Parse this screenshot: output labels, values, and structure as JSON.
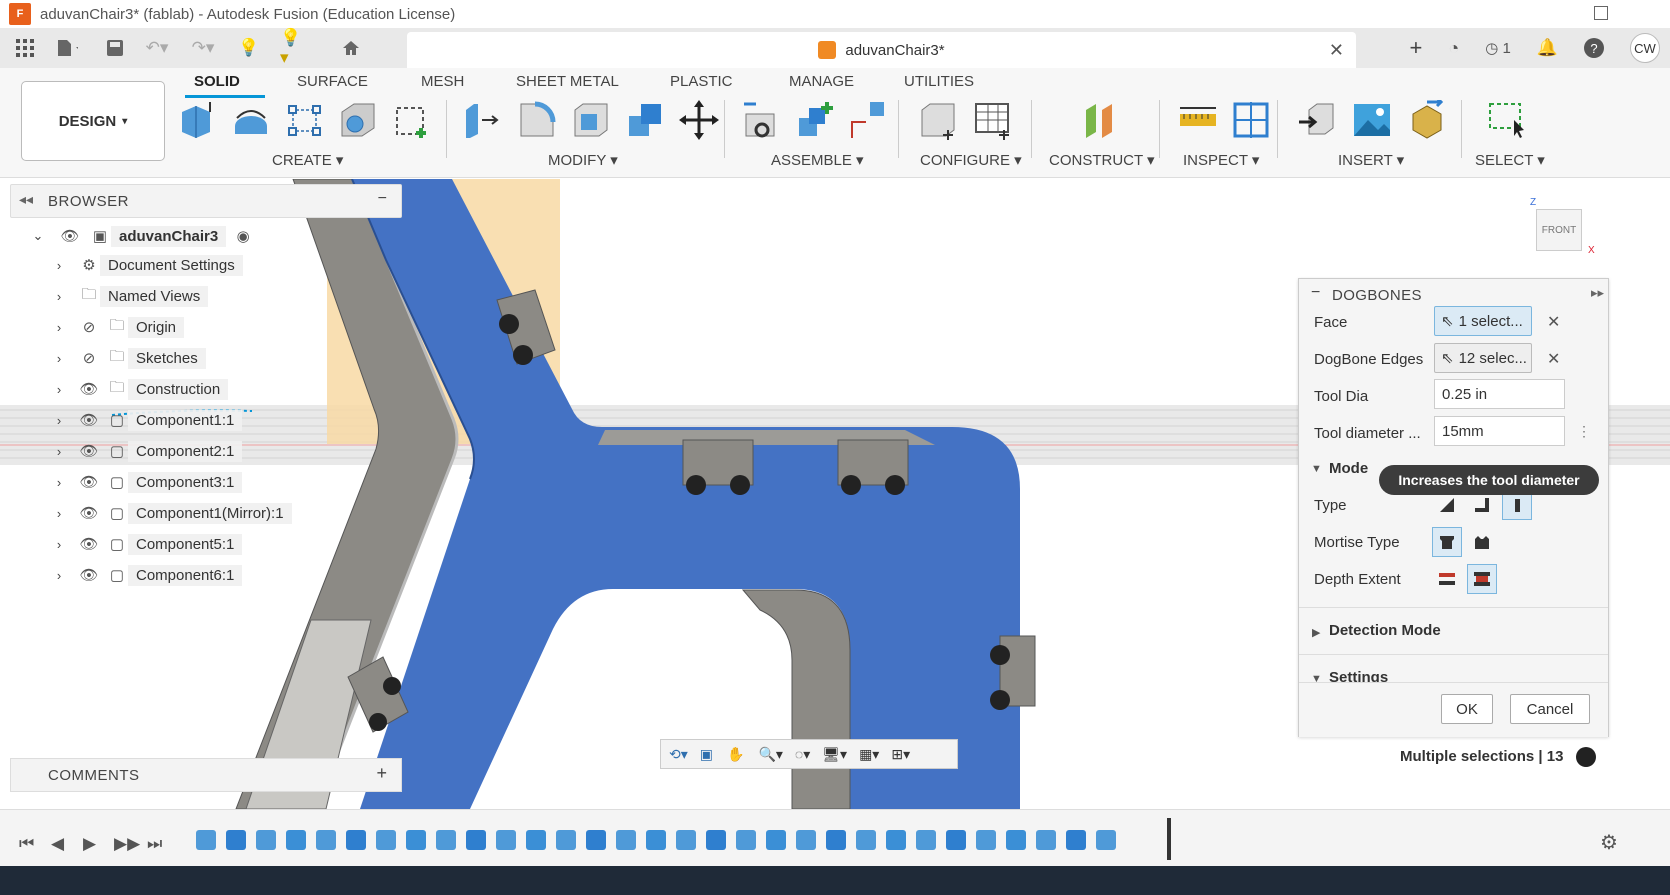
{
  "window": {
    "title": "aduvanChair3* (fablab) - Autodesk Fusion (Education License)",
    "app_logo_text": "F"
  },
  "tab": {
    "name": "aduvanChair3*",
    "close_icon": "close-icon"
  },
  "toolbar_right": {
    "jobs_count": "1",
    "user_initials": "CW"
  },
  "workspace": {
    "label": "DESIGN"
  },
  "ribbon_tabs": [
    {
      "label": "SOLID",
      "active": true
    },
    {
      "label": "SURFACE"
    },
    {
      "label": "MESH"
    },
    {
      "label": "SHEET METAL"
    },
    {
      "label": "PLASTIC"
    },
    {
      "label": "MANAGE"
    },
    {
      "label": "UTILITIES"
    }
  ],
  "ribbon_groups": [
    {
      "label": "CREATE"
    },
    {
      "label": "MODIFY"
    },
    {
      "label": "ASSEMBLE"
    },
    {
      "label": "CONFIGURE"
    },
    {
      "label": "CONSTRUCT"
    },
    {
      "label": "INSPECT"
    },
    {
      "label": "INSERT"
    },
    {
      "label": "SELECT"
    }
  ],
  "browser": {
    "title": "BROWSER",
    "root": "aduvanChair3",
    "items": [
      {
        "label": "Document Settings",
        "icon": "gear-icon"
      },
      {
        "label": "Named Views",
        "icon": "folder-icon"
      },
      {
        "label": "Origin",
        "icon": "folder-icon",
        "hidden": true
      },
      {
        "label": "Sketches",
        "icon": "folder-icon",
        "hidden": true
      },
      {
        "label": "Construction",
        "icon": "folder-icon"
      },
      {
        "label": "Component1:1",
        "icon": "component-icon"
      },
      {
        "label": "Component2:1",
        "icon": "component-icon"
      },
      {
        "label": "Component3:1",
        "icon": "component-icon"
      },
      {
        "label": "Component1(Mirror):1",
        "icon": "component-icon"
      },
      {
        "label": "Component5:1",
        "icon": "component-icon"
      },
      {
        "label": "Component6:1",
        "icon": "component-icon"
      }
    ]
  },
  "comments": {
    "title": "COMMENTS"
  },
  "viewcube": {
    "face": "FRONT",
    "axis_z": "Z",
    "axis_x": "X"
  },
  "dogbones": {
    "title": "DOGBONES",
    "face_label": "Face",
    "face_value": "1 select...",
    "edges_label": "DogBone Edges",
    "edges_value": "12 selec...",
    "tool_dia_label": "Tool Dia",
    "tool_dia_value": "0.25 in",
    "tool_diameter_label": "Tool diameter ...",
    "tool_diameter_value": "15mm",
    "tooltip": "Increases the tool diameter",
    "mode_label": "Mode",
    "type_label": "Type",
    "mortise_label": "Mortise Type",
    "depth_label": "Depth Extent",
    "detection_label": "Detection Mode",
    "settings_label": "Settings",
    "ok": "OK",
    "cancel": "Cancel"
  },
  "status": {
    "selection": "Multiple selections | 13"
  },
  "colors": {
    "accent": "#0696d7",
    "body_blue": "#4472c4",
    "body_grey": "#8c8a85",
    "highlight_orange": "#f8d9a4"
  }
}
